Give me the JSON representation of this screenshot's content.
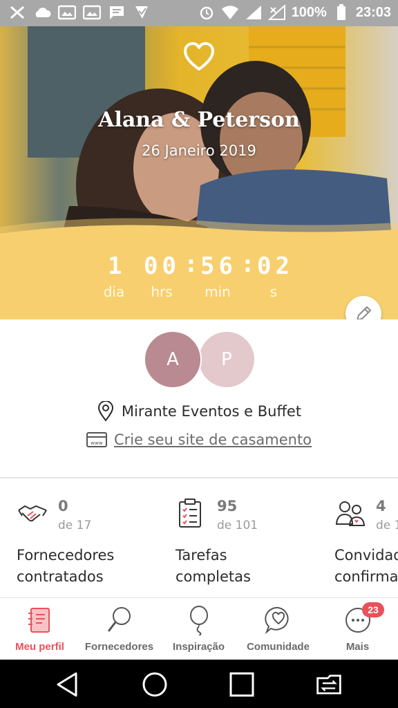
{
  "status_bar": {
    "battery": "100%",
    "time": "23:03",
    "left_icons": [
      "tools-icon",
      "cloud-icon",
      "photo-icon",
      "photo-icon",
      "message-icon",
      "check-icon"
    ],
    "right_icons": [
      "alarm-icon",
      "wifi-icon",
      "signal-icon",
      "signal-off-icon"
    ]
  },
  "hero": {
    "names": "Alana & Peterson",
    "date": "26 Janeiro 2019",
    "countdown": {
      "days": "1",
      "hours": "00",
      "minutes": "56",
      "seconds": "02",
      "labels": {
        "days": "dia",
        "hours": "hrs",
        "minutes": "min",
        "seconds": "s"
      }
    },
    "colors": {
      "band": "#f8cf6e"
    }
  },
  "profile": {
    "avatar_a": "A",
    "avatar_p": "P",
    "venue": "Mirante Eventos e Buffet",
    "site_link": "Crie seu site de casamento"
  },
  "stats": [
    {
      "count": "0",
      "total": "de 17",
      "label_line1": "Fornecedores",
      "label_line2": "contratados",
      "icon": "handshake-icon"
    },
    {
      "count": "95",
      "total": "de 101",
      "label_line1": "Tarefas",
      "label_line2": "completas",
      "icon": "clipboard-icon"
    },
    {
      "count": "4",
      "total": "de 1",
      "label_line1": "Convidad",
      "label_line2": "confirma",
      "icon": "guests-icon"
    }
  ],
  "bottom_nav": {
    "items": [
      {
        "label": "Meu perfil",
        "icon": "profile-book-icon",
        "active": true
      },
      {
        "label": "Fornecedores",
        "icon": "search-icon"
      },
      {
        "label": "Inspiração",
        "icon": "balloon-icon"
      },
      {
        "label": "Comunidade",
        "icon": "heart-bubble-icon"
      },
      {
        "label": "Mais",
        "icon": "more-icon",
        "badge": "23"
      }
    ],
    "colors": {
      "active": "#e8515b",
      "inactive": "#6a6a6a"
    }
  }
}
